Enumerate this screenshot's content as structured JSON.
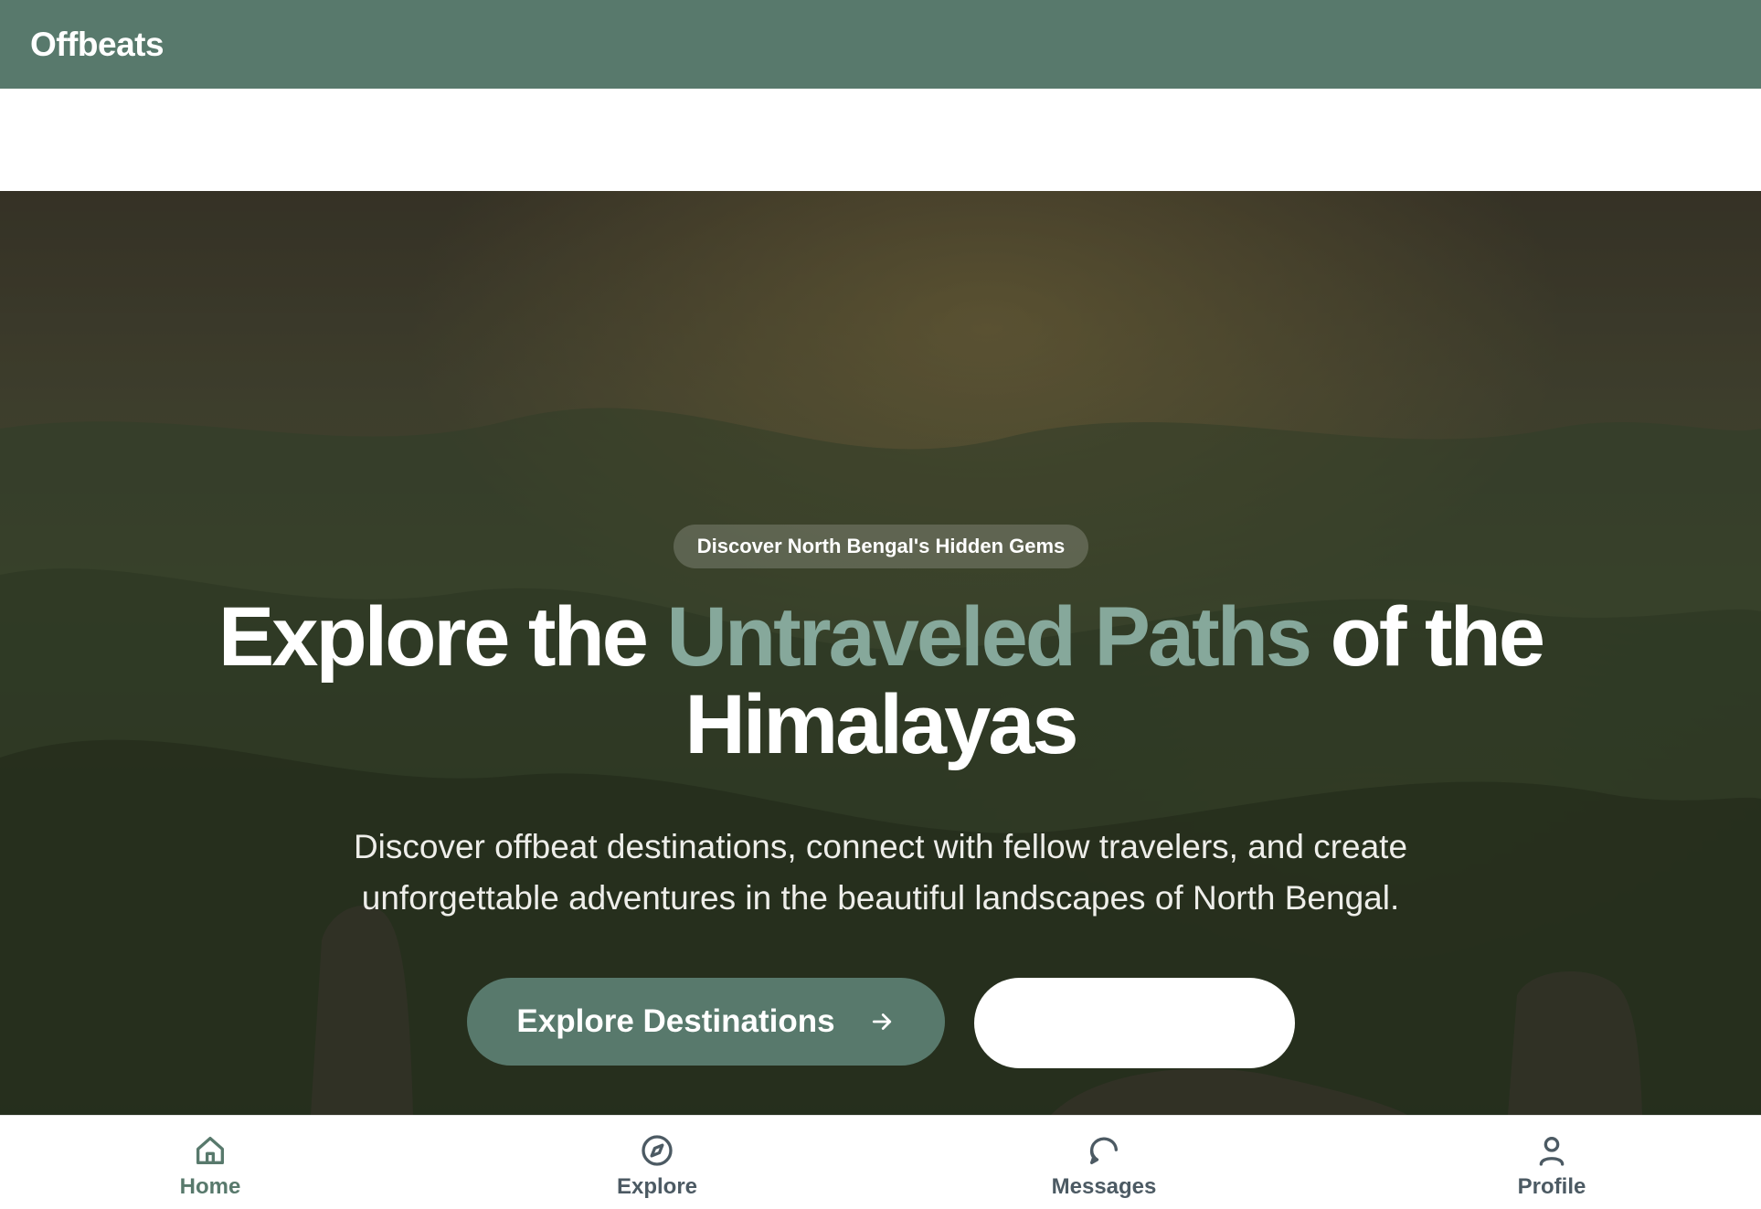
{
  "header": {
    "brand": "Offbeats"
  },
  "hero": {
    "badge": "Discover North Bengal's Hidden Gems",
    "headline_part1": "Explore the ",
    "headline_accent": "Untraveled Paths",
    "headline_part2": " of the Himalayas",
    "subtext": "Discover offbeat destinations, connect with fellow travelers, and create unforgettable adventures in the beautiful landscapes of North Bengal.",
    "primary_button": {
      "label": "Explore Destinations",
      "icon": "arrow-right-icon"
    },
    "secondary_button": {
      "label": ""
    }
  },
  "bottom_nav": {
    "items": [
      {
        "label": "Home",
        "icon": "home-icon",
        "active": true
      },
      {
        "label": "Explore",
        "icon": "compass-icon",
        "active": false
      },
      {
        "label": "Messages",
        "icon": "message-circle-icon",
        "active": false
      },
      {
        "label": "Profile",
        "icon": "user-icon",
        "active": false
      }
    ]
  },
  "colors": {
    "brand": "#58796c",
    "accent_text": "#86a89b",
    "nav_text": "#4c5a63",
    "white": "#ffffff"
  }
}
